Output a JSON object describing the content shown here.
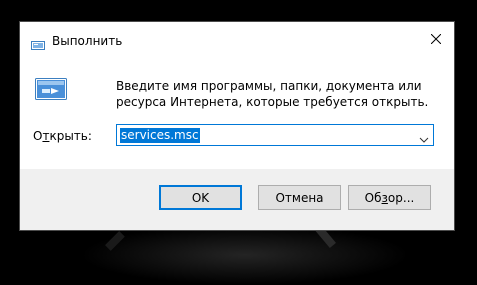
{
  "window": {
    "title": "Выполнить",
    "icon": "run-dialog-icon",
    "close_icon": "close-icon"
  },
  "content": {
    "description": "Введите имя программы, папки, документа или ресурса Интернета, которые требуется открыть.",
    "open_label_pre": "О",
    "open_label_accel": "т",
    "open_label_post": "крыть:",
    "open_value": "services.msc"
  },
  "buttons": {
    "ok": "OK",
    "cancel": "Отмена",
    "browse_pre": "Об",
    "browse_accel": "з",
    "browse_post": "ор..."
  },
  "colors": {
    "accent": "#0078d7",
    "footer_bg": "#f0f0f0",
    "button_bg": "#e1e1e1"
  }
}
